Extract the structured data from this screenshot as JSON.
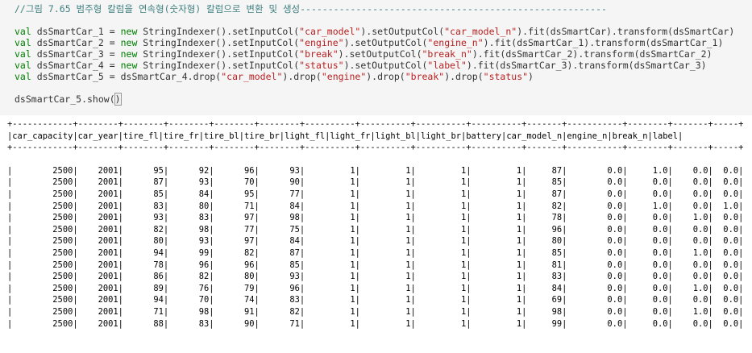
{
  "code": {
    "comment": "//그림 7.65 범주형 칼럼을 연속형(숫자형) 칼럼으로 변환 및 생성-------------------------------------------------------",
    "statements": [
      {
        "var": "dsSmartCar_1",
        "source": "dsSmartCar",
        "input": "\"car_model\"",
        "output": "\"car_model_n\"",
        "fit": "dsSmartCar",
        "transform": "dsSmartCar"
      },
      {
        "var": "dsSmartCar_2",
        "source": "dsSmartCar_1",
        "input": "\"engine\"",
        "output": "\"engine_n\"",
        "fit": "dsSmartCar_1",
        "transform": "dsSmartCar_1"
      },
      {
        "var": "dsSmartCar_3",
        "source": "dsSmartCar_2",
        "input": "\"break\"",
        "output": "\"break_n\"",
        "fit": "dsSmartCar_2",
        "transform": "dsSmartCar_2"
      },
      {
        "var": "dsSmartCar_4",
        "source": "dsSmartCar_3",
        "input": "\"status\"",
        "output": "\"label\"",
        "fit": "dsSmartCar_3",
        "transform": "dsSmartCar_3"
      }
    ],
    "line5": {
      "var": "dsSmartCar_5",
      "expr_a": "dsSmartCar_4.drop(",
      "s1": "\"car_model\"",
      "mid1": ").drop(",
      "s2": "\"engine\"",
      "mid2": ").drop(",
      "s3": "\"break\"",
      "mid3": ").drop(",
      "s4": "\"status\"",
      "end": ")"
    },
    "show_prefix": "dsSmartCar_5.show(",
    "show_suffix": ")",
    "keyword_val": "val",
    "keyword_new": "new",
    "class_name": "StringIndexer",
    "set_input": "().setInputCol(",
    "set_output": ").setOutputCol(",
    "fit_open": ").fit(",
    "transform_open": ").transform(",
    "close": ")",
    "equals": " = "
  },
  "output": {
    "border": "+------------+--------+--------+--------+--------+--------+----------+----------+----------+----------+-------+-----------+--------+-------+-----+",
    "header": "|car_capacity|car_year|tire_fl|tire_fr|tire_bl|tire_br|light_fl|light_fr|light_bl|light_br|battery|car_model_n|engine_n|break_n|label|",
    "columns": [
      "car_capacity",
      "car_year",
      "tire_fl",
      "tire_fr",
      "tire_bl",
      "tire_br",
      "light_fl",
      "light_fr",
      "light_bl",
      "light_br",
      "battery",
      "car_model_n",
      "engine_n",
      "break_n",
      "label"
    ],
    "rows": [
      [
        "2500",
        "2001",
        "95",
        "92",
        "96",
        "93",
        "1",
        "1",
        "1",
        "1",
        "87",
        "0.0",
        "1.0",
        "0.0",
        "0.0"
      ],
      [
        "2500",
        "2001",
        "87",
        "93",
        "70",
        "90",
        "1",
        "1",
        "1",
        "1",
        "85",
        "0.0",
        "0.0",
        "0.0",
        "0.0"
      ],
      [
        "2500",
        "2001",
        "85",
        "84",
        "95",
        "77",
        "1",
        "1",
        "1",
        "1",
        "87",
        "0.0",
        "0.0",
        "0.0",
        "0.0"
      ],
      [
        "2500",
        "2001",
        "83",
        "80",
        "71",
        "84",
        "1",
        "1",
        "1",
        "1",
        "82",
        "0.0",
        "1.0",
        "0.0",
        "1.0"
      ],
      [
        "2500",
        "2001",
        "93",
        "83",
        "97",
        "98",
        "1",
        "1",
        "1",
        "1",
        "78",
        "0.0",
        "0.0",
        "1.0",
        "0.0"
      ],
      [
        "2500",
        "2001",
        "82",
        "98",
        "77",
        "75",
        "1",
        "1",
        "1",
        "1",
        "96",
        "0.0",
        "0.0",
        "0.0",
        "0.0"
      ],
      [
        "2500",
        "2001",
        "80",
        "93",
        "97",
        "84",
        "1",
        "1",
        "1",
        "1",
        "80",
        "0.0",
        "0.0",
        "0.0",
        "0.0"
      ],
      [
        "2500",
        "2001",
        "94",
        "99",
        "82",
        "87",
        "1",
        "1",
        "1",
        "1",
        "85",
        "0.0",
        "0.0",
        "1.0",
        "0.0"
      ],
      [
        "2500",
        "2001",
        "78",
        "96",
        "96",
        "85",
        "1",
        "1",
        "1",
        "1",
        "81",
        "0.0",
        "0.0",
        "0.0",
        "0.0"
      ],
      [
        "2500",
        "2001",
        "86",
        "82",
        "80",
        "93",
        "1",
        "1",
        "1",
        "1",
        "83",
        "0.0",
        "0.0",
        "0.0",
        "0.0"
      ],
      [
        "2500",
        "2001",
        "89",
        "76",
        "79",
        "96",
        "1",
        "1",
        "1",
        "1",
        "84",
        "0.0",
        "0.0",
        "1.0",
        "0.0"
      ],
      [
        "2500",
        "2001",
        "94",
        "70",
        "74",
        "83",
        "1",
        "1",
        "1",
        "1",
        "69",
        "0.0",
        "0.0",
        "0.0",
        "0.0"
      ],
      [
        "2500",
        "2001",
        "71",
        "98",
        "91",
        "82",
        "1",
        "1",
        "1",
        "1",
        "98",
        "0.0",
        "0.0",
        "1.0",
        "0.0"
      ],
      [
        "2500",
        "2001",
        "88",
        "83",
        "90",
        "71",
        "1",
        "1",
        "1",
        "1",
        "99",
        "0.0",
        "0.0",
        "0.0",
        "0.0"
      ]
    ]
  }
}
